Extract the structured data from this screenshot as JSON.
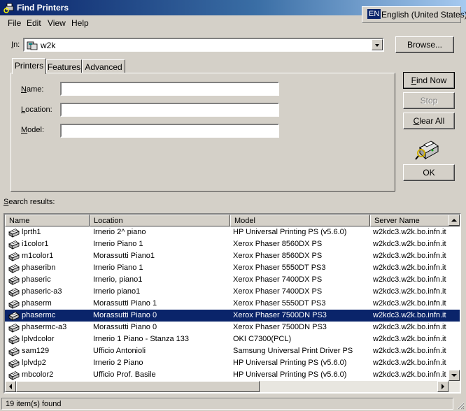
{
  "window": {
    "title": "Find Printers",
    "title_icon": "find-printers-icon"
  },
  "language_bar": {
    "code": "EN",
    "name": "English (United States)"
  },
  "menu": {
    "items": [
      "File",
      "Edit",
      "View",
      "Help"
    ]
  },
  "in_field": {
    "label_key": "I",
    "label_rest": "n:",
    "value": "w2k",
    "icon": "domain-icon"
  },
  "buttons": {
    "browse": "Browse...",
    "find_now_key": "F",
    "find_now_rest": "ind Now",
    "stop": "Stop",
    "clear_all_key": "C",
    "clear_all_rest": "lear All",
    "ok": "OK"
  },
  "tabs": [
    "Printers",
    "Features",
    "Advanced"
  ],
  "search_fields": {
    "name_key": "N",
    "name_rest": "ame:",
    "name_value": "",
    "location_key": "L",
    "location_rest": "ocation:",
    "location_value": "",
    "model_key": "M",
    "model_rest": "odel:",
    "model_value": ""
  },
  "results_label_key": "S",
  "results_label_rest": "earch results:",
  "columns": [
    "Name",
    "Location",
    "Model",
    "Server Name"
  ],
  "rows": [
    {
      "name": "lprth1",
      "location": "Irnerio 2^ piano",
      "model": "HP Universal Printing PS (v5.6.0)",
      "server": "w2kdc3.w2k.bo.infn.it",
      "selected": false
    },
    {
      "name": "i1color1",
      "location": "Irnerio Piano 1",
      "model": "Xerox Phaser 8560DX PS",
      "server": "w2kdc3.w2k.bo.infn.it",
      "selected": false
    },
    {
      "name": "m1color1",
      "location": "Morassutti Piano1",
      "model": "Xerox Phaser 8560DX PS",
      "server": "w2kdc3.w2k.bo.infn.it",
      "selected": false
    },
    {
      "name": "phaseribn",
      "location": "Irnerio Piano 1",
      "model": "Xerox Phaser 5550DT PS3",
      "server": "w2kdc3.w2k.bo.infn.it",
      "selected": false
    },
    {
      "name": "phaseric",
      "location": "Irnerio, piano1",
      "model": "Xerox Phaser 7400DX PS",
      "server": "w2kdc3.w2k.bo.infn.it",
      "selected": false
    },
    {
      "name": "phaseric-a3",
      "location": "Irnerio piano1",
      "model": "Xerox Phaser 7400DX PS",
      "server": "w2kdc3.w2k.bo.infn.it",
      "selected": false
    },
    {
      "name": "phaserm",
      "location": "Morassutti Piano 1",
      "model": "Xerox Phaser 5550DT PS3",
      "server": "w2kdc3.w2k.bo.infn.it",
      "selected": false
    },
    {
      "name": "phasermc",
      "location": "Morassutti Piano 0",
      "model": "Xerox Phaser 7500DN PS3",
      "server": "w2kdc3.w2k.bo.infn.it",
      "selected": true
    },
    {
      "name": "phasermc-a3",
      "location": "Morassutti Piano 0",
      "model": "Xerox Phaser 7500DN PS3",
      "server": "w2kdc3.w2k.bo.infn.it",
      "selected": false
    },
    {
      "name": "lplvdcolor",
      "location": "Irnerio 1 Piano - Stanza 133",
      "model": "OKI C7300(PCL)",
      "server": "w2kdc3.w2k.bo.infn.it",
      "selected": false
    },
    {
      "name": "sam129",
      "location": "Ufficio Antonioli",
      "model": "Samsung Universal Print Driver PS",
      "server": "w2kdc3.w2k.bo.infn.it",
      "selected": false
    },
    {
      "name": "lplvdp2",
      "location": "Irnerio 2 Piano",
      "model": "HP Universal Printing PS (v5.6.0)",
      "server": "w2kdc3.w2k.bo.infn.it",
      "selected": false
    },
    {
      "name": "mbcolor2",
      "location": "Ufficio Prof. Basile",
      "model": "HP Universal Printing PS (v5.6.0)",
      "server": "w2kdc3.w2k.bo.infn.it",
      "selected": false
    }
  ],
  "row_icon": "printer-icon",
  "status": {
    "text": "19 item(s) found"
  },
  "colors": {
    "title_start": "#0a246a",
    "title_end": "#a6caf0",
    "selection": "#0a246a",
    "face": "#d4d0c8"
  }
}
